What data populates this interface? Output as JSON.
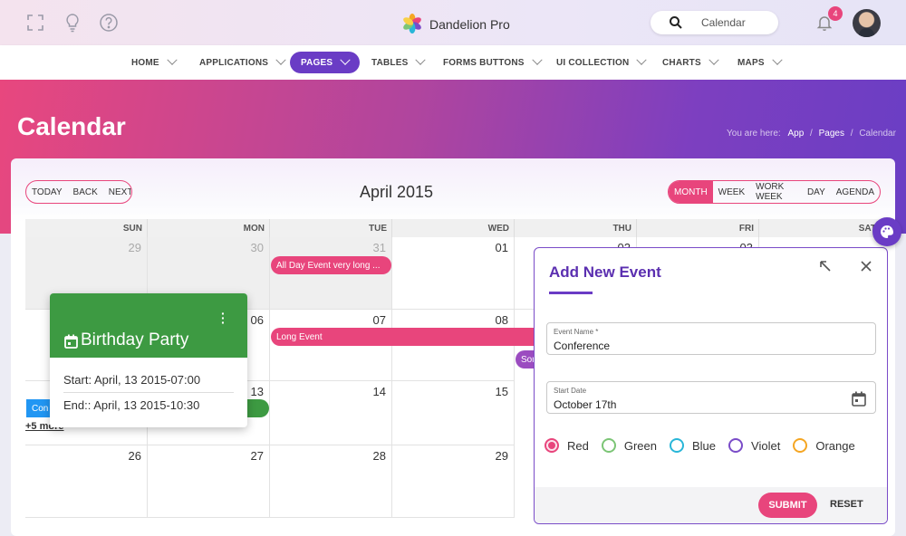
{
  "header": {
    "brand": "Dandelion Pro",
    "search_value": "Calendar",
    "notification_count": "4",
    "icons": [
      "fullscreen-icon",
      "lightbulb-icon",
      "help-icon",
      "search-icon",
      "bell-icon"
    ]
  },
  "nav": {
    "items": [
      {
        "label": "HOME"
      },
      {
        "label": "APPLICATIONS"
      },
      {
        "label": "PAGES",
        "active": true
      },
      {
        "label": "TABLES"
      },
      {
        "label": "FORMS BUTTONS"
      },
      {
        "label": "UI COLLECTION"
      },
      {
        "label": "CHARTS"
      },
      {
        "label": "MAPS"
      }
    ]
  },
  "page": {
    "title": "Calendar",
    "breadcrumb": {
      "prefix": "You are here:",
      "items": [
        "App",
        "Pages"
      ],
      "current": "Calendar",
      "sep": "/"
    }
  },
  "toolbar": {
    "nav_buttons": [
      "TODAY",
      "BACK",
      "NEXT"
    ],
    "title": "April 2015",
    "views": [
      "MONTH",
      "WEEK",
      "WORK WEEK",
      "DAY",
      "AGENDA"
    ],
    "active_view": "MONTH"
  },
  "calendar": {
    "day_headers": [
      "SUN",
      "MON",
      "TUE",
      "WED",
      "THU",
      "FRI",
      "SAT"
    ],
    "weeks": [
      [
        "29",
        "30",
        "31",
        "01",
        "02",
        "03",
        "04"
      ],
      [
        "",
        "06",
        "07",
        "08",
        "",
        "",
        ""
      ],
      [
        "",
        "",
        "14",
        "15",
        "",
        "",
        ""
      ],
      [
        "26",
        "27",
        "28",
        "29",
        "",
        "",
        ""
      ]
    ],
    "cell_13": "13",
    "events": {
      "all_day": "All Day Event very long ...",
      "long": "Long Event",
      "some": "Som",
      "conf": "Con"
    },
    "more": "+5 more"
  },
  "popup": {
    "title": "Birthday Party",
    "start": "Start: April, 13 2015-07:00",
    "end": "End:: April, 13 2015-10:30"
  },
  "dialog": {
    "title": "Add New Event",
    "event_name_label": "Event Name *",
    "event_name_value": "Conference",
    "start_date_label": "Start Date",
    "start_date_value": "October 17th",
    "colors": [
      {
        "label": "Red",
        "color": "#e8457c",
        "selected": true
      },
      {
        "label": "Green",
        "color": "#7cc576"
      },
      {
        "label": "Blue",
        "color": "#29b6d8"
      },
      {
        "label": "Violet",
        "color": "#7a4cc8"
      },
      {
        "label": "Orange",
        "color": "#f5a623"
      }
    ],
    "submit": "SUBMIT",
    "reset": "RESET"
  },
  "colors": {
    "accent": "#e8457c",
    "primary": "#6a3cc5",
    "event_green": "#3d9a42",
    "event_blue": "#2196f3"
  }
}
